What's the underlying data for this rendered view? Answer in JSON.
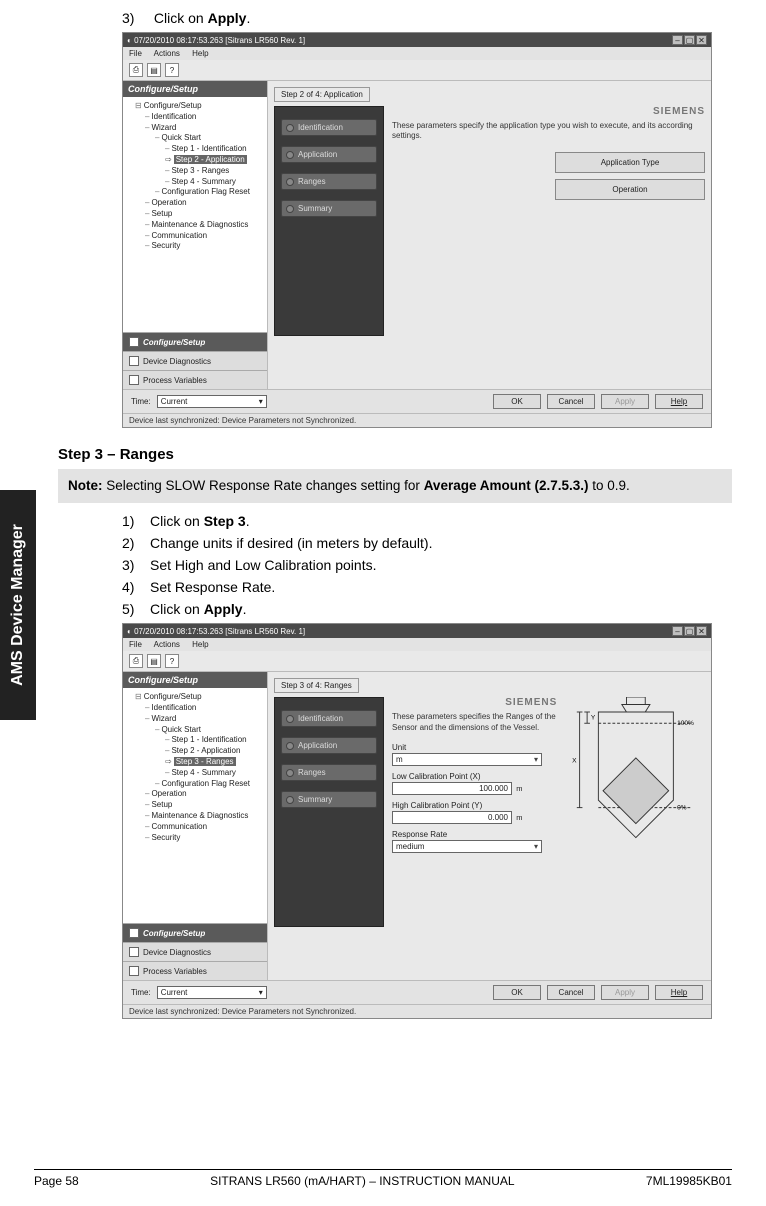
{
  "side_tab": "AMS Device Manager",
  "intro_step": {
    "num": "3)",
    "pre": "Click on ",
    "bold": "Apply",
    "post": "."
  },
  "section_title": "Step 3 – Ranges",
  "note": {
    "label": "Note:",
    "pre": " Selecting SLOW Response Rate changes setting for ",
    "bold": "Average Amount (2.7.5.3.)",
    "post": " to 0.9."
  },
  "steps": {
    "s1": {
      "num": "1)",
      "pre": "Click on ",
      "bold": "Step 3",
      "post": "."
    },
    "s2": {
      "num": "2)",
      "text": "Change units if desired (in meters by default)."
    },
    "s3": {
      "num": "3)",
      "text": "Set High and Low Calibration points."
    },
    "s4": {
      "num": "4)",
      "text": "Set Response Rate."
    },
    "s5": {
      "num": "5)",
      "pre": "Click on ",
      "bold": "Apply",
      "post": "."
    }
  },
  "window_common": {
    "title": "07/20/2010 08:17:53.263 [Sitrans LR560 Rev. 1]",
    "menu": {
      "file": "File",
      "actions": "Actions",
      "help": "Help"
    },
    "sidebar_header": "Configure/Setup",
    "tree": {
      "root": "Configure/Setup",
      "identification": "Identification",
      "wizard": "Wizard",
      "quick": "Quick Start",
      "s1": "Step 1 - Identification",
      "s2": "Step 2 - Application",
      "s3": "Step 3 - Ranges",
      "s4": "Step 4 - Summary",
      "cfg_reset": "Configuration Flag Reset",
      "operation": "Operation",
      "setup": "Setup",
      "maint": "Maintenance & Diagnostics",
      "comm": "Communication",
      "security": "Security"
    },
    "bottom_nav": {
      "configure": "Configure/Setup",
      "diagnostics": "Device Diagnostics",
      "process": "Process Variables"
    },
    "footer": {
      "time_label": "Time:",
      "time_value": "Current",
      "ok": "OK",
      "cancel": "Cancel",
      "apply": "Apply",
      "help": "Help"
    },
    "status": "Device last synchronized: Device Parameters not Synchronized.",
    "siemens": "SIEMENS",
    "nav_items": {
      "identification": "Identification",
      "application": "Application",
      "ranges": "Ranges",
      "summary": "Summary"
    }
  },
  "window1": {
    "tab": "Step 2 of 4: Application",
    "desc": "These parameters specify the application type you wish to execute, and its according settings.",
    "btn1": "Application Type",
    "btn2": "Operation"
  },
  "window2": {
    "tab": "Step 3 of 4: Ranges",
    "desc": "These parameters specifies the Ranges of the Sensor and the dimensions of the Vessel.",
    "unit_label": "Unit",
    "unit_value": "m",
    "low_label": "Low Calibration Point (X)",
    "low_value": "100.000",
    "low_unit": "m",
    "high_label": "High Calibration Point (Y)",
    "high_value": "0.000",
    "high_unit": "m",
    "rate_label": "Response Rate",
    "rate_value": "medium",
    "vessel_100": "100%",
    "vessel_0": "0%",
    "vessel_y": "Y",
    "vessel_x": "X"
  },
  "page_footer": {
    "left": "Page 58",
    "center": "SITRANS LR560 (mA/HART) – INSTRUCTION MANUAL",
    "right": "7ML19985KB01"
  }
}
